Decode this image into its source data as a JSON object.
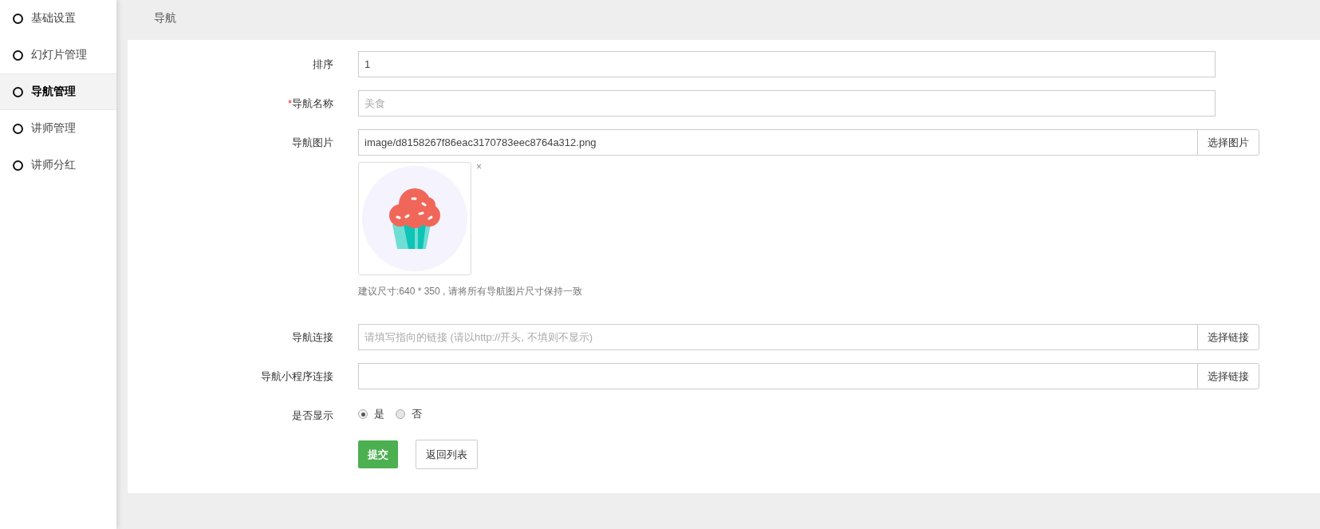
{
  "sidebar": {
    "items": [
      {
        "label": "基础设置",
        "selected": false
      },
      {
        "label": "幻灯片管理",
        "selected": false
      },
      {
        "label": "导航管理",
        "selected": true
      },
      {
        "label": "讲师管理",
        "selected": false
      },
      {
        "label": "讲师分红",
        "selected": false
      }
    ]
  },
  "header": {
    "title": "导航"
  },
  "form": {
    "rows": [
      {
        "kind": "text",
        "label": "排序",
        "value": "1"
      },
      {
        "kind": "text",
        "label": "导航名称",
        "required_mark": "*",
        "placeholder": "美食"
      },
      {
        "kind": "image",
        "label": "导航图片",
        "value": "image/d8158267f86eac3170783eec8764a312.png",
        "button": "选择图片",
        "remove": "×",
        "hint": "建议尺寸:640 * 350 , 请将所有导航图片尺寸保持一致"
      },
      {
        "kind": "link",
        "label": "导航连接",
        "placeholder": "请填写指向的链接 (请以http://开头, 不填则不显示)",
        "button": "选择链接"
      },
      {
        "kind": "link",
        "label": "导航小程序连接",
        "button": "选择链接"
      },
      {
        "kind": "radio",
        "label": "是否显示",
        "options": [
          {
            "label": "是",
            "selected": true
          },
          {
            "label": "否",
            "selected": false
          }
        ]
      }
    ],
    "buttons": [
      {
        "kind": "primary",
        "label": "提交"
      },
      {
        "kind": "default",
        "label": "返回列表"
      }
    ]
  }
}
